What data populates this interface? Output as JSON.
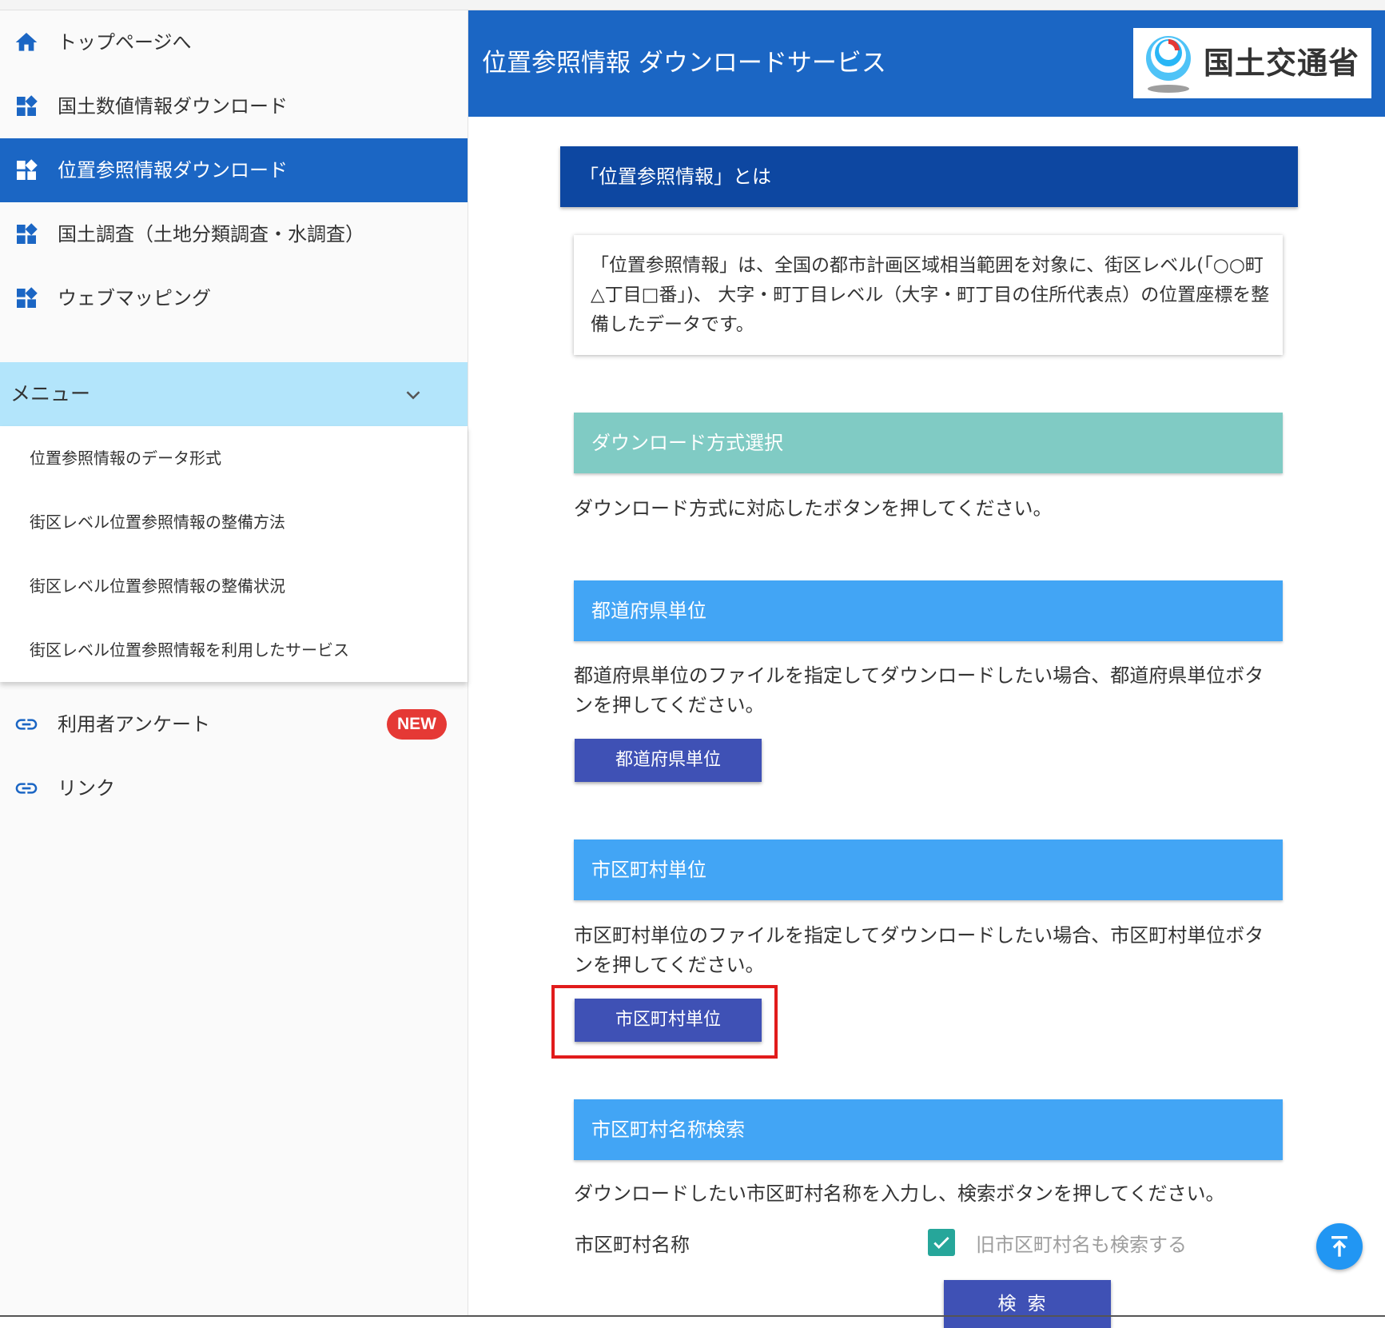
{
  "sidebar": {
    "nav": [
      {
        "label": "トップページへ",
        "icon": "home-icon"
      },
      {
        "label": "国土数値情報ダウンロード",
        "icon": "widgets-icon"
      },
      {
        "label": "位置参照情報ダウンロード",
        "icon": "widgets-icon",
        "active": true
      },
      {
        "label": "国土調査（土地分類調査・水調査）",
        "icon": "widgets-icon"
      },
      {
        "label": "ウェブマッピング",
        "icon": "widgets-icon"
      }
    ],
    "menu": {
      "label": "メニュー",
      "icon": "chevron-down-icon",
      "items": [
        {
          "label": "位置参照情報のデータ形式"
        },
        {
          "label": "街区レベル位置参照情報の整備方法"
        },
        {
          "label": "街区レベル位置参照情報の整備状況"
        },
        {
          "label": "街区レベル位置参照情報を利用したサービス"
        }
      ]
    },
    "links": [
      {
        "label": "利用者アンケート",
        "icon": "link-icon",
        "badge": "NEW"
      },
      {
        "label": "リンク",
        "icon": "link-icon"
      }
    ]
  },
  "header": {
    "title": "位置参照情報 ダウンロードサービス",
    "logo_text": "国土交通省"
  },
  "main": {
    "about": {
      "heading": "「位置参照情報」とは",
      "body": "「位置参照情報」は、全国の都市計画区域相当範囲を対象に、街区レベル(「○○町△丁目□番」)、 大字・町丁目レベル（大字・町丁目の住所代表点）の位置座標を整備したデータです。"
    },
    "method": {
      "heading": "ダウンロード方式選択",
      "body": "ダウンロード方式に対応したボタンを押してください。"
    },
    "prefecture": {
      "heading": "都道府県単位",
      "body": "都道府県単位のファイルを指定してダウンロードしたい場合、都道府県単位ボタンを押してください。",
      "button": "都道府県単位"
    },
    "municipality": {
      "heading": "市区町村単位",
      "body": "市区町村単位のファイルを指定してダウンロードしたい場合、市区町村単位ボタンを押してください。",
      "button": "市区町村単位"
    },
    "name_search": {
      "heading": "市区町村名称検索",
      "body": "ダウンロードしたい市区町村名称を入力し、検索ボタンを押してください。",
      "field_label": "市区町村名称",
      "checkbox_label": "旧市区町村名も検索する",
      "checkbox_checked": true,
      "search_button": "検索"
    }
  },
  "colors": {
    "primary": "#1b66c4",
    "dark_heading": "#0d47a1",
    "teal_heading": "#80cbc4",
    "blue_heading": "#42a5f5",
    "button": "#3f51b5",
    "menu_bg": "#b3e5fb",
    "highlight": "#e11b1b",
    "badge": "#e53935"
  },
  "fab_icon": "scroll-to-top-icon"
}
